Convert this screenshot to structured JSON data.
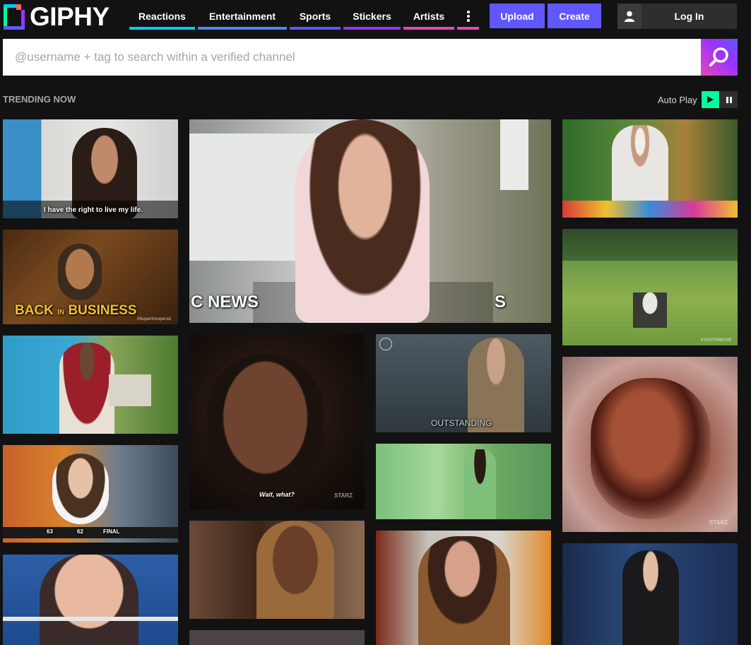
{
  "brand": {
    "name": "GIPHY"
  },
  "nav": [
    {
      "label": "Reactions",
      "color": "#00ccff"
    },
    {
      "label": "Entertainment",
      "color": "#3d8eff"
    },
    {
      "label": "Sports",
      "color": "#6157ff"
    },
    {
      "label": "Stickers",
      "color": "#9933ff"
    },
    {
      "label": "Artists",
      "color": "#e646b6"
    }
  ],
  "more_icon": "vertical-ellipsis-icon",
  "actions": {
    "upload": "Upload",
    "create": "Create",
    "login": "Log In"
  },
  "search": {
    "placeholder": "@username + tag to search within a verified channel"
  },
  "trending": {
    "title": "TRENDING NOW",
    "autoplay_label": "Auto Play"
  },
  "gifs": {
    "kourtney_caption": "I have the right to live my life.",
    "business_caption_a": "BACK",
    "business_caption_in": "IN",
    "business_caption_b": "BUSINESS",
    "business_tag": "#Supertroopers2",
    "wait_caption": "Wait, what?",
    "wait_watermark": "STARZ",
    "outstanding_caption": "OUTSTANDING",
    "news_text_a": "C NEWS",
    "news_text_b": "S",
    "youth_tag": "#YOUTHMOVIE",
    "score_a": "63",
    "score_b": "62",
    "score_final": "FINAL",
    "sparkle_watermark": "STARZ"
  }
}
